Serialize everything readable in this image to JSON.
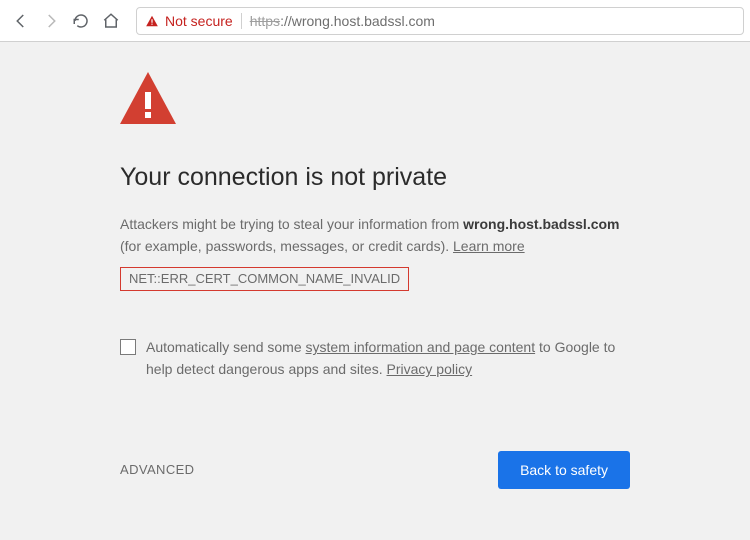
{
  "toolbar": {
    "security_label": "Not secure",
    "url_protocol": "https",
    "url_sep": "://",
    "url_host": "wrong.host.badssl.com"
  },
  "page": {
    "title": "Your connection is not private",
    "warn_pre": "Attackers might be trying to steal your information from ",
    "warn_host": "wrong.host.badssl.com",
    "warn_post": " (for example, passwords, messages, or credit cards). ",
    "learn_more": "Learn more",
    "error_code": "NET::ERR_CERT_COMMON_NAME_INVALID",
    "opt_pre": "Automatically send some ",
    "opt_link1": "system information and page content",
    "opt_mid": " to Google to help detect dangerous apps and sites. ",
    "opt_link2": "Privacy policy",
    "advanced": "ADVANCED",
    "back_to_safety": "Back to safety"
  },
  "colors": {
    "danger": "#c5221f",
    "primary": "#1a73e8"
  }
}
